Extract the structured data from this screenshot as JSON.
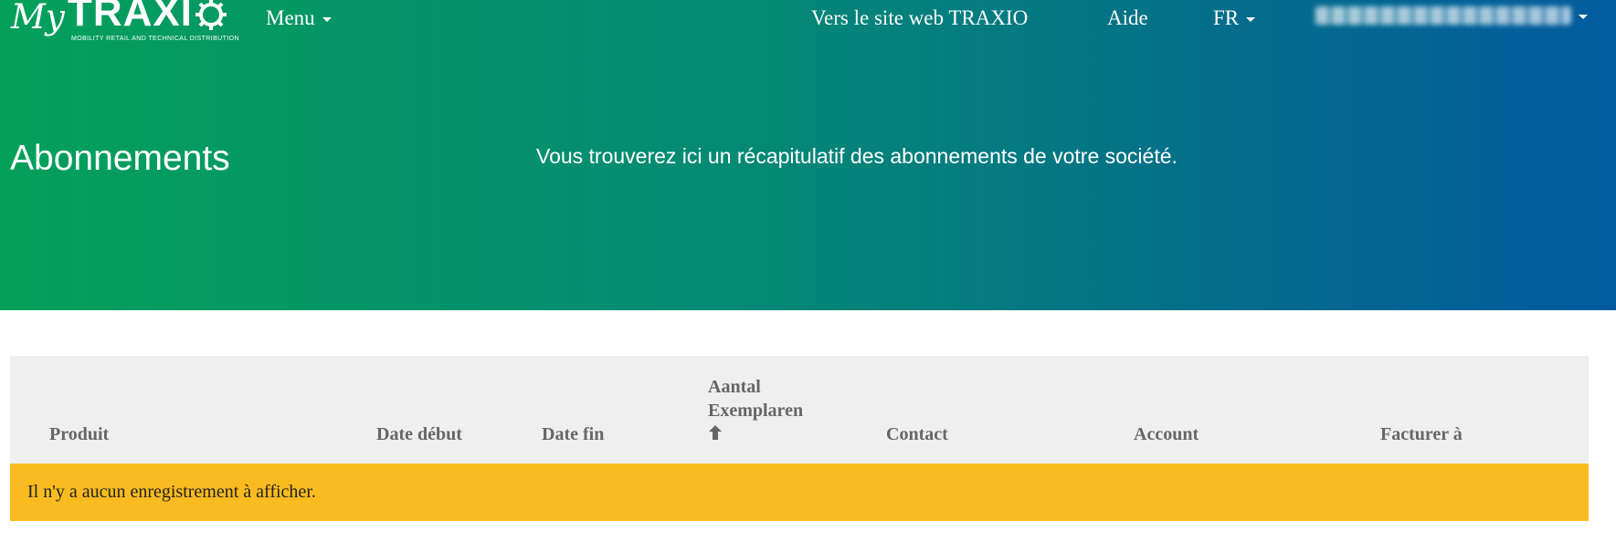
{
  "brand": {
    "my": "My",
    "name": "TRAXI",
    "tagline": "MOBILITY RETAIL AND TECHNICAL DISTRIBUTION"
  },
  "nav": {
    "menu_label": "Menu",
    "website_label": "Vers le site web TRAXIO",
    "help_label": "Aide",
    "language_label": "FR"
  },
  "page": {
    "title": "Abonnements",
    "subtitle": "Vous trouverez ici un récapitulatif des abonnements de votre société."
  },
  "table": {
    "columns": [
      "Produit",
      "Date début",
      "Date fin",
      "Aantal Exemplaren",
      "Contact",
      "Account",
      "Facturer à"
    ],
    "sorted_column_icon": "arrow-up-icon",
    "empty_message": "Il n'y a aucun enregistrement à afficher."
  },
  "colors": {
    "hero_gradient_start": "#04a05a",
    "hero_gradient_end": "#035b9f",
    "table_header_bg": "#efefef",
    "empty_row_bg": "#f9bb1f"
  }
}
